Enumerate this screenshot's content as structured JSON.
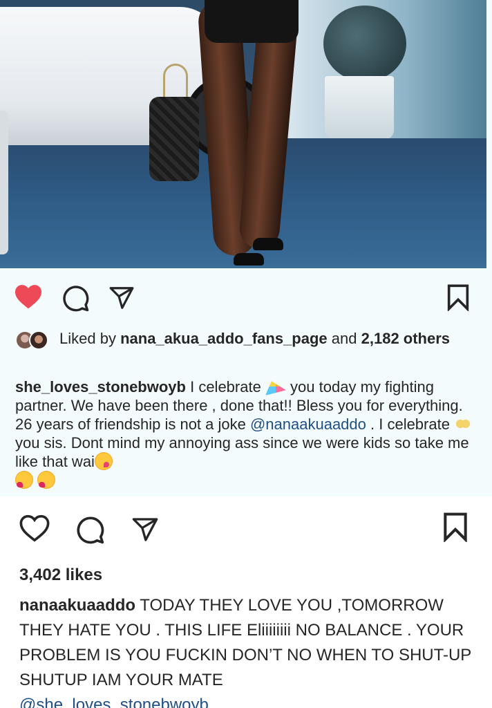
{
  "post1": {
    "liked_by_prefix": "Liked by",
    "liked_by_user": "nana_akua_addo_fans_page",
    "liked_by_and": "and",
    "liked_by_count": "2,182 others",
    "like_active": true,
    "heart_color": "#ed4956",
    "caption": {
      "username": "she_loves_stonebwoyb",
      "text_1": " I celebrate ",
      "text_2": " you today my fighting partner. We have been there , done that!! Bless you for everything. 26 years of friendship is not a joke ",
      "mention": "@nanaakuaaddo",
      "text_3": " . I celebrate ",
      "text_4": " you sis. Dont mind my annoying ass since we were kids so take me like that wai",
      "emojis": [
        "party-popper-emoji",
        "clinking-glasses-emoji",
        "winking-tongue-emoji",
        "kiss-face-emoji",
        "kiss-face-emoji"
      ]
    }
  },
  "post2": {
    "likes": "3,402 likes",
    "caption": {
      "username": "nanaakuaaddo",
      "text": " TODAY THEY LOVE YOU ,TOMORROW THEY HATE YOU . THIS LIFE Eliiiiiiii  NO BALANCE . YOUR PROBLEM IS YOU FUCKIN DON’T NO WHEN TO SHUT-UP  SHUTUP IAM YOUR MATE",
      "mention": "@she_loves_stonebwoyb"
    }
  },
  "icons": {
    "like": "heart-icon",
    "comment": "comment-bubble-icon",
    "share": "paper-plane-icon",
    "save": "bookmark-icon"
  },
  "colors": {
    "text": "#262626",
    "mention": "#1f4f86",
    "post1_bg": "#f4fbfd"
  }
}
